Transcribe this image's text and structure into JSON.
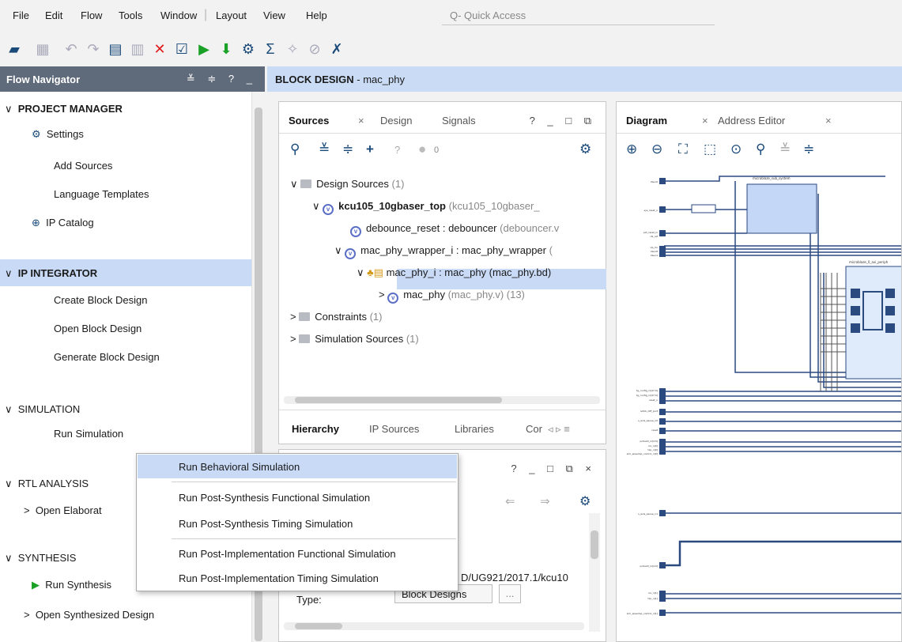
{
  "menubar": {
    "items": [
      {
        "label": "File",
        "u": "F"
      },
      {
        "label": "Edit",
        "u": "E"
      },
      {
        "label": "Flow",
        "u": "l"
      },
      {
        "label": "Tools",
        "u": "T"
      },
      {
        "label": "Window",
        "u": "W"
      },
      {
        "label": "Layout",
        "u": "y"
      },
      {
        "label": "View",
        "u": "V"
      },
      {
        "label": "Help",
        "u": "H"
      }
    ],
    "quick_access": "Q- Quick Access"
  },
  "flow_navigator": {
    "title": "Flow Navigator",
    "controls": "≚ ≑ ? _",
    "sections": [
      {
        "label": "PROJECT MANAGER",
        "items": [
          "Settings",
          "Add Sources",
          "Language Templates",
          "IP Catalog"
        ]
      },
      {
        "label": "IP INTEGRATOR",
        "items": [
          "Create Block Design",
          "Open Block Design",
          "Generate Block Design"
        ]
      },
      {
        "label": "SIMULATION",
        "items": [
          "Run Simulation"
        ]
      },
      {
        "label": "RTL ANALYSIS",
        "items": [
          "Open Elaborated Design"
        ]
      },
      {
        "label": "SYNTHESIS",
        "items": [
          "Run Synthesis",
          "Open Synthesized Design"
        ]
      }
    ],
    "rtl_item_truncated": "Open Elaborat"
  },
  "block_design": {
    "title_bold": "BLOCK DESIGN",
    "title_rest": " - mac_phy"
  },
  "sources": {
    "tabs": [
      "Sources",
      "Design",
      "Signals"
    ],
    "controls": "? _ □ ⧉",
    "badge_count": "0",
    "tree": {
      "design_sources": "Design Sources",
      "design_sources_count": "(1)",
      "top_name": "kcu105_10gbaser_top",
      "top_file": "(kcu105_10gbaser_",
      "debounce": "debounce_reset : debouncer",
      "debounce_file": "(debouncer.v",
      "wrapper": "mac_phy_wrapper_i : mac_phy_wrapper",
      "wrapper_file": "(",
      "bd": "mac_phy_i : mac_phy",
      "bd_file": "(mac_phy.bd)",
      "macphy": "mac_phy",
      "macphy_file": "(mac_phy.v) (13)",
      "constraints": "Constraints",
      "constraints_count": "(1)",
      "sim_sources": "Simulation Sources",
      "sim_sources_count": "(1)"
    },
    "bottom_tabs": [
      "Hierarchy",
      "IP Sources",
      "Libraries",
      "Cor"
    ]
  },
  "properties": {
    "controls": "? _ □ ⧉ ×",
    "path_fragment": "D/UG921/2017.1/kcu10",
    "type_label": "Type:",
    "type_value": "Block Designs",
    "more": "..."
  },
  "diagram": {
    "tabs": [
      "Diagram",
      "Address Editor"
    ],
    "blocks": [
      "microblaze_sub_system",
      "microblaze_0_axi_periph"
    ],
    "ports_left": [
      "Vaux0",
      "sys_reset_n",
      "ext_reset_in",
      "clk_ref",
      "Vp_Vn",
      "Vaux8",
      "Vaux1"
    ],
    "ports_mid": [
      "tg_config_in[47:0]",
      "tg_config_in[47:0]",
      "reset_n",
      "refclk_diff_port",
      "s_axis_pause_n0",
      "reset",
      "pcbadd_in[4:0]",
      "rxc_n[0]",
      "txp_n[0]",
      "sim_speedup_control_n[0]"
    ],
    "ports_bottom": [
      "s_axis_pause_n1",
      "pcbadd_in[4:0]",
      "rxc_n[1]",
      "txp_n[1]",
      "sim_speedup_control_n[1]"
    ]
  },
  "context_menu": {
    "items": [
      "Run Behavioral Simulation",
      "Run Post-Synthesis Functional Simulation",
      "Run Post-Synthesis Timing Simulation",
      "Run Post-Implementation Functional Simulation",
      "Run Post-Implementation Timing Simulation"
    ]
  },
  "colors": {
    "accent": "#c9daf7",
    "header": "#5f6b7a",
    "run": "#1aa127",
    "delete": "#e01b1b"
  }
}
